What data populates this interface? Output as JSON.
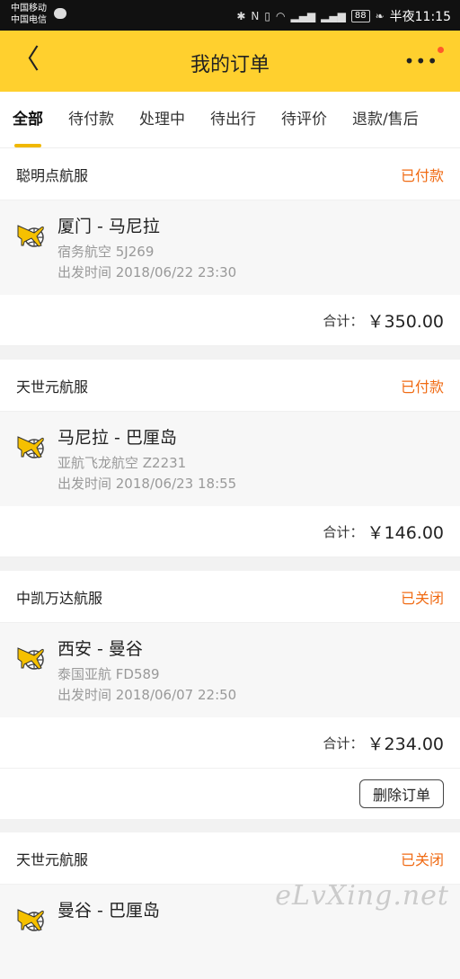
{
  "status_bar": {
    "carrier_1": "中国移动",
    "carrier_2": "中国电信",
    "battery": "88",
    "time": "半夜11:15"
  },
  "header": {
    "title": "我的订单"
  },
  "tabs": [
    {
      "label": "全部",
      "active": true
    },
    {
      "label": "待付款"
    },
    {
      "label": "处理中"
    },
    {
      "label": "待出行"
    },
    {
      "label": "待评价"
    },
    {
      "label": "退款/售后"
    }
  ],
  "orders": [
    {
      "agency": "聪明点航服",
      "status": "已付款",
      "route": "厦门 - 马尼拉",
      "airline": "宿务航空 5J269",
      "departure": "出发时间 2018/06/22 23:30",
      "total_label": "合计：",
      "total": "￥350.00"
    },
    {
      "agency": "天世元航服",
      "status": "已付款",
      "route": "马尼拉 - 巴厘岛",
      "airline": "亚航飞龙航空 Z2231",
      "departure": "出发时间 2018/06/23 18:55",
      "total_label": "合计：",
      "total": "￥146.00"
    },
    {
      "agency": "中凯万达航服",
      "status": "已关闭",
      "route": "西安 - 曼谷",
      "airline": "泰国亚航 FD589",
      "departure": "出发时间 2018/06/07 22:50",
      "total_label": "合计：",
      "total": "￥234.00",
      "action": "删除订单"
    },
    {
      "agency": "天世元航服",
      "status": "已关闭",
      "route": "曼谷 - 巴厘岛"
    }
  ],
  "watermark": "eLvXing.net",
  "colors": {
    "brand_yellow": "#ffd02e",
    "status_orange": "#f06b14",
    "tab_indicator": "#f0b800"
  }
}
